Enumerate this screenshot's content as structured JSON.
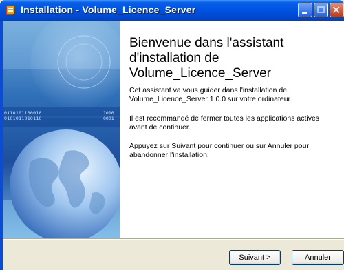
{
  "window": {
    "title": "Installation - Volume_Licence_Server"
  },
  "banner": {
    "binary_line_1": "0110101100010",
    "binary_line_2": "0101011010110",
    "binary_line_3": "1010",
    "binary_line_4": "0001"
  },
  "content": {
    "heading": "Bienvenue dans l'assistant d'installation de Volume_Licence_Server",
    "paragraph_1": "Cet assistant va vous guider dans l'installation de Volume_Licence_Server 1.0.0 sur votre ordinateur.",
    "paragraph_2": "Il est recommandé de fermer toutes les applications actives avant de continuer.",
    "paragraph_3": "Appuyez sur Suivant pour continuer ou sur Annuler pour abandonner l'installation."
  },
  "footer": {
    "next_label": "Suivant >",
    "cancel_label": "Annuler"
  },
  "colors": {
    "titlebar": "#0054e3",
    "banner_dark": "#0a3a8a",
    "banner_light": "#8fc3ee",
    "dialog_face": "#ece9d8"
  }
}
